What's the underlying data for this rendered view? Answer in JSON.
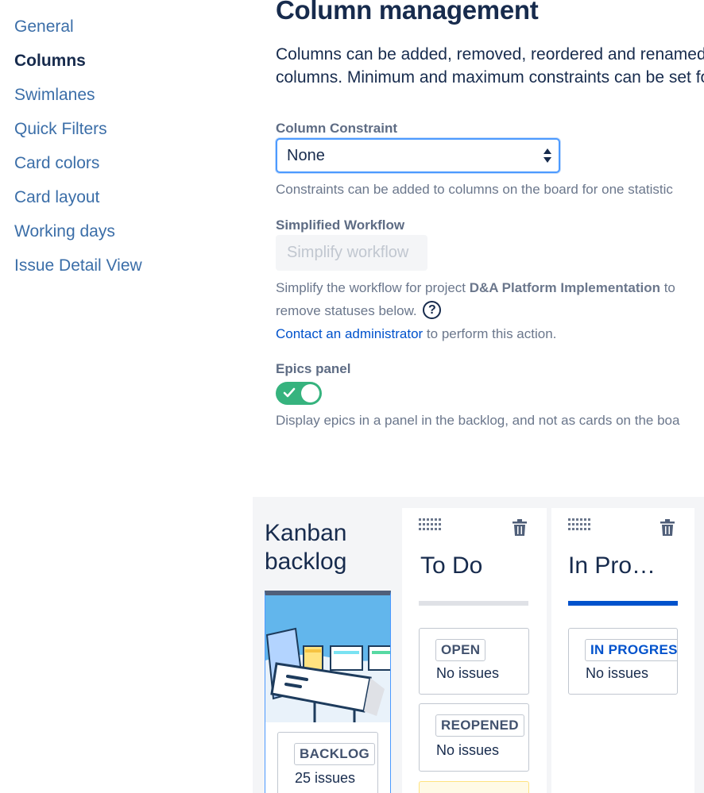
{
  "sidebar": {
    "items": [
      {
        "label": "General"
      },
      {
        "label": "Columns"
      },
      {
        "label": "Swimlanes"
      },
      {
        "label": "Quick Filters"
      },
      {
        "label": "Card colors"
      },
      {
        "label": "Card layout"
      },
      {
        "label": "Working days"
      },
      {
        "label": "Issue Detail View"
      }
    ],
    "active": "Columns"
  },
  "main": {
    "title": "Column management",
    "intro_line1": "Columns can be added, removed, reordered and renamed.",
    "intro_line2": "columns. Minimum and maximum constraints can be set fo",
    "constraint": {
      "label": "Column Constraint",
      "value": "None",
      "help": "Constraints can be added to columns on the board for one statistic"
    },
    "workflow": {
      "label": "Simplified Workflow",
      "button": "Simplify workflow",
      "help_prefix": "Simplify the workflow for project ",
      "project": "D&A Platform Implementation",
      "help_suffix": " to",
      "help_line2": "remove statuses below.",
      "help_icon": "?",
      "contact_link": "Contact an administrator",
      "contact_suffix": " to perform this action."
    },
    "epics": {
      "label": "Epics panel",
      "enabled": true,
      "help": "Display epics in a panel in the backlog, and not as cards on the boa"
    }
  },
  "board": {
    "backlog": {
      "title_line1": "Kanban",
      "title_line2": "backlog",
      "status": "BACKLOG",
      "count": "25 issues"
    },
    "columns": [
      {
        "title": "To Do",
        "bar_color": "#dfe1e6",
        "statuses": [
          {
            "name": "OPEN",
            "count": "No issues"
          },
          {
            "name": "REOPENED",
            "count": "No issues"
          }
        ]
      },
      {
        "title": "In Pro…",
        "bar_color": "#0052cc",
        "statuses": [
          {
            "name": "IN PROGRESS",
            "count": "No issues"
          }
        ]
      }
    ]
  },
  "colors": {
    "link": "#3b6ea8",
    "primary": "#0052cc",
    "toggle_on": "#36b37e",
    "focus_border": "#4c9aff"
  }
}
